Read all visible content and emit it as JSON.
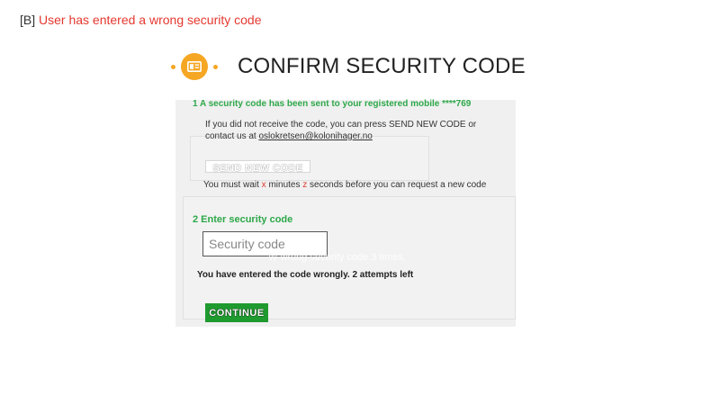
{
  "slide": {
    "tag": "[B]",
    "caption": "User has entered a wrong security code"
  },
  "header": {
    "title": "CONFIRM SECURITY CODE",
    "logo_icon": "id-card-icon",
    "accent_color": "#f5a623"
  },
  "step1": {
    "heading": "1  A security code has been sent to your registered mobile ****769",
    "info_prefix": "If you did not receive the code, you can press SEND NEW CODE or contact us at ",
    "email": "oslokretsen@kolonihager.no",
    "send_button_label": "SEND NEW CODE",
    "wait_part1": "You must wait ",
    "wait_x": "x",
    "wait_part2": " minutes ",
    "wait_z": "z",
    "wait_part3": " seconds before you can request a new code"
  },
  "step2": {
    "heading": "2  Enter security code",
    "input_placeholder": "Security code",
    "input_value": "",
    "ghost_text": "W wrong security code 3 times,",
    "error_message": "You have entered the code wrongly. 2 attempts left",
    "continue_label": "CONTINUE",
    "continue_color": "#1f9a2f"
  },
  "colors": {
    "green_heading": "#2ea84a",
    "red_accent": "#e5382f",
    "panel_bg": "#f0f0f0"
  }
}
